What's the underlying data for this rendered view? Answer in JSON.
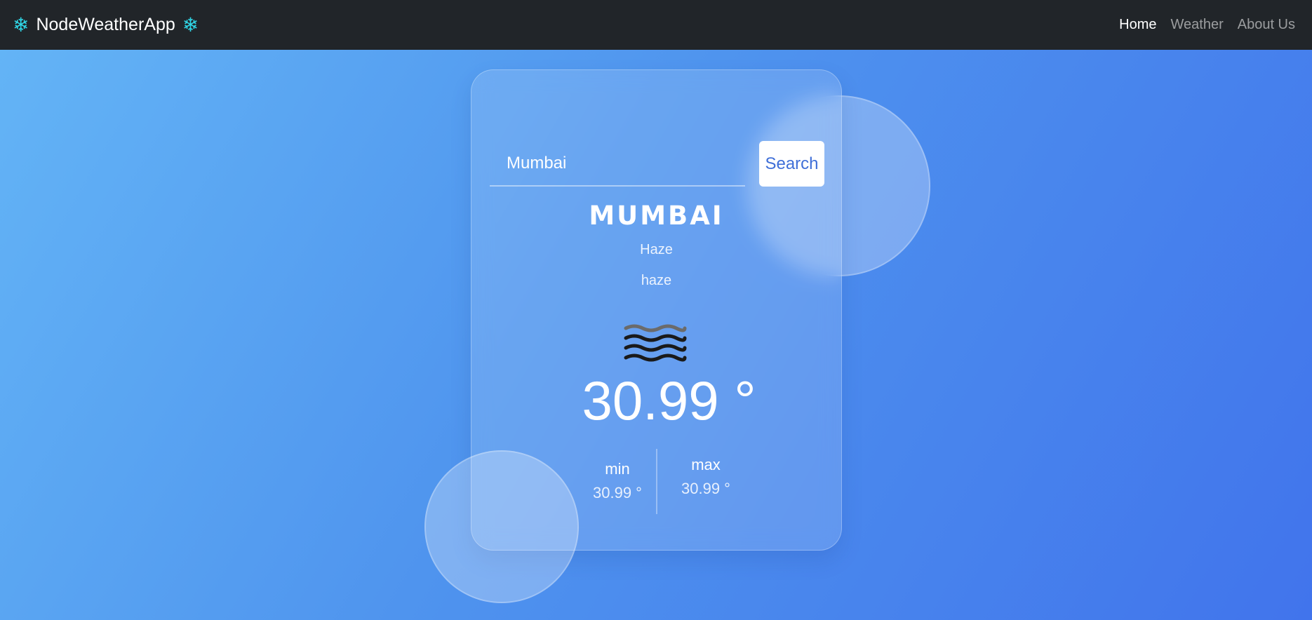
{
  "app": {
    "brand": "NodeWeatherApp",
    "brand_icon": "snowflake-icon",
    "accent_color": "#2fd6e6"
  },
  "nav": {
    "items": [
      {
        "label": "Home",
        "active": true
      },
      {
        "label": "Weather",
        "active": false
      },
      {
        "label": "About Us",
        "active": false
      }
    ]
  },
  "search": {
    "value": "Mumbai",
    "button_label": "Search"
  },
  "weather": {
    "city": "MUMBAI",
    "condition_main": "Haze",
    "condition_description": "haze",
    "icon": "haze-icon",
    "temperature": "30.99 °",
    "min_label": "min",
    "min_value": "30.99 °",
    "max_label": "max",
    "max_value": "30.99 °"
  }
}
